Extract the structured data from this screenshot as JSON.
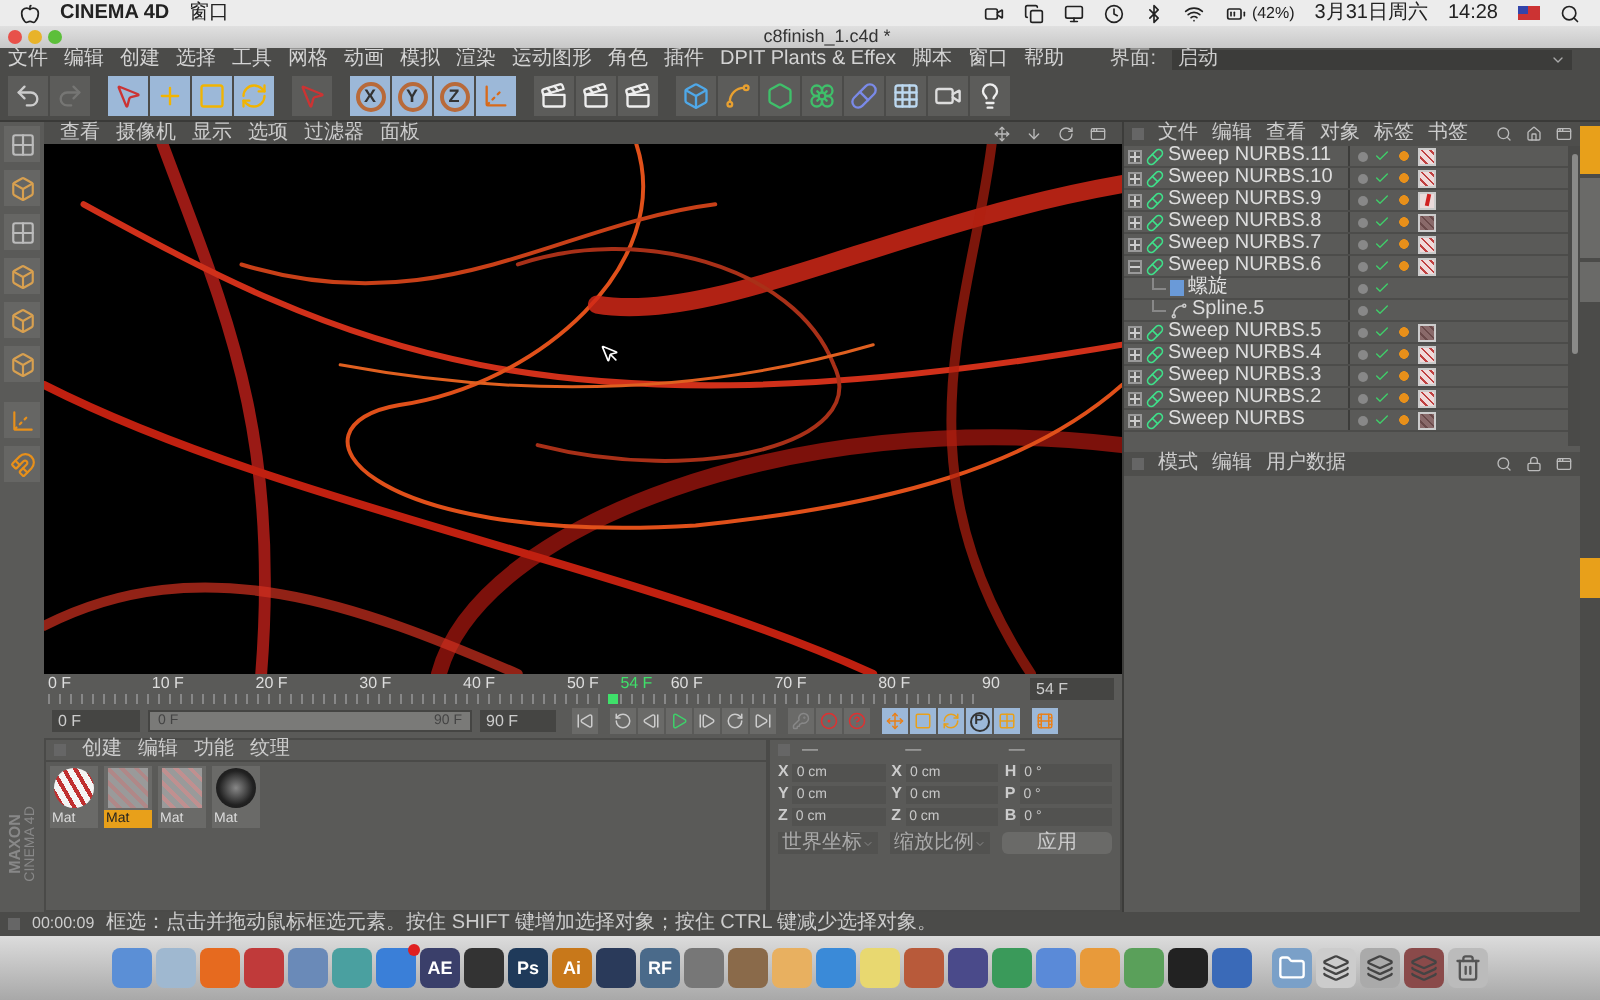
{
  "menubar": {
    "app": "CINEMA 4D",
    "menu": "窗口",
    "battery": "(42%)",
    "date": "3月31日周六",
    "time": "14:28"
  },
  "window": {
    "title": "c8finish_1.c4d *"
  },
  "menu": [
    "文件",
    "编辑",
    "创建",
    "选择",
    "工具",
    "网格",
    "动画",
    "模拟",
    "渲染",
    "运动图形",
    "角色",
    "插件",
    "DPIT Plants & Effex",
    "脚本",
    "窗口",
    "帮助"
  ],
  "layout": {
    "label": "界面:",
    "value": "启动"
  },
  "toolbar": [
    {
      "kind": "undo",
      "active": false
    },
    {
      "kind": "redo",
      "active": false,
      "disabled": true
    },
    {
      "kind": "select",
      "active": true
    },
    {
      "kind": "move",
      "active": true
    },
    {
      "kind": "scale",
      "active": true
    },
    {
      "kind": "rotate",
      "active": true
    },
    {
      "kind": "select",
      "active": false
    },
    {
      "kind": "axis",
      "label": "X",
      "active": true
    },
    {
      "kind": "axis",
      "label": "Y",
      "active": true
    },
    {
      "kind": "axis",
      "label": "Z",
      "active": true
    },
    {
      "kind": "coords",
      "active": true
    },
    {
      "kind": "render",
      "active": false
    },
    {
      "kind": "render",
      "active": false
    },
    {
      "kind": "render",
      "active": false
    },
    {
      "kind": "cube",
      "active": false
    },
    {
      "kind": "spline",
      "active": false
    },
    {
      "kind": "nurbs",
      "active": false
    },
    {
      "kind": "array",
      "active": false
    },
    {
      "kind": "deformer",
      "active": false
    },
    {
      "kind": "floor",
      "active": false
    },
    {
      "kind": "camera",
      "active": false
    },
    {
      "kind": "light",
      "active": false
    }
  ],
  "left_tools": [
    {
      "kind": "checker"
    },
    {
      "kind": "cube"
    },
    {
      "kind": "checker"
    },
    {
      "kind": "cube"
    },
    {
      "kind": "cube"
    },
    {
      "kind": "cube"
    },
    {
      "kind": "axis"
    },
    {
      "kind": "magnet"
    }
  ],
  "viewport": {
    "menu": [
      "查看",
      "摄像机",
      "显示",
      "选项",
      "过滤器",
      "面板"
    ]
  },
  "timeline": {
    "ticks": [
      "0 F",
      "10 F",
      "20 F",
      "30 F",
      "40 F",
      "50 F",
      "60 F",
      "70 F",
      "80 F",
      "90"
    ],
    "current": "54 F",
    "level": 0.6,
    "frame_field": "54 F"
  },
  "range": {
    "start": "0 F",
    "slider_start": "0 F",
    "slider_end": "90 F",
    "end": "90 F",
    "level": 1
  },
  "transport": [
    {
      "kind": "first"
    },
    {
      "kind": "loop-back"
    },
    {
      "kind": "prev"
    },
    {
      "kind": "play"
    },
    {
      "kind": "next"
    },
    {
      "kind": "loop"
    },
    {
      "kind": "last"
    },
    {
      "kind": "key"
    },
    {
      "kind": "record"
    },
    {
      "kind": "help"
    },
    {
      "kind": "move"
    },
    {
      "kind": "scale"
    },
    {
      "kind": "rotate"
    },
    {
      "kind": "param",
      "label": "P"
    },
    {
      "kind": "grid"
    },
    {
      "kind": "film"
    }
  ],
  "materials": {
    "menu": [
      "创建",
      "编辑",
      "功能",
      "纹理"
    ],
    "items": [
      {
        "label": "Mat",
        "kind": "striped-sphere",
        "selected": false
      },
      {
        "label": "Mat",
        "kind": "red",
        "selected": true
      },
      {
        "label": "Mat",
        "kind": "striped",
        "selected": false
      },
      {
        "label": "Mat",
        "kind": "dark-sphere",
        "selected": false
      }
    ]
  },
  "logo": {
    "brand": "MAXON",
    "product": "CINEMA 4D"
  },
  "coordinates": {
    "headers": [
      "—",
      "—",
      "—"
    ],
    "rows": [
      {
        "cells": [
          {
            "axis": "X",
            "value": "0 cm"
          },
          {
            "axis": "X",
            "value": "0 cm"
          },
          {
            "axis": "H",
            "value": "0 °"
          }
        ]
      },
      {
        "cells": [
          {
            "axis": "Y",
            "value": "0 cm"
          },
          {
            "axis": "Y",
            "value": "0 cm"
          },
          {
            "axis": "P",
            "value": "0 °"
          }
        ]
      },
      {
        "cells": [
          {
            "axis": "Z",
            "value": "0 cm"
          },
          {
            "axis": "Z",
            "value": "0 cm"
          },
          {
            "axis": "B",
            "value": "0 °"
          }
        ]
      }
    ],
    "mode": "世界坐标",
    "scale": "缩放比例",
    "apply": "应用"
  },
  "objects": {
    "menu": [
      "文件",
      "编辑",
      "查看",
      "对象",
      "标签",
      "书签"
    ],
    "items": [
      {
        "name": "Sweep NURBS.11",
        "kind": "sweep",
        "expanded": false,
        "material_tag": {
          "kind": "light"
        }
      },
      {
        "name": "Sweep NURBS.10",
        "kind": "sweep",
        "expanded": false,
        "material_tag": {
          "kind": "light"
        }
      },
      {
        "name": "Sweep NURBS.9",
        "kind": "sweep",
        "expanded": false,
        "material_tag": {
          "kind": "red"
        }
      },
      {
        "name": "Sweep NURBS.8",
        "kind": "sweep",
        "expanded": false,
        "material_tag": {
          "kind": "dark"
        }
      },
      {
        "name": "Sweep NURBS.7",
        "kind": "sweep",
        "expanded": false,
        "material_tag": {
          "kind": "light"
        }
      },
      {
        "name": "Sweep NURBS.6",
        "kind": "sweep",
        "expanded": true,
        "material_tag": {
          "kind": "light"
        },
        "children": [
          {
            "name": "螺旋",
            "kind": "helix"
          },
          {
            "name": "Spline.5",
            "kind": "spline"
          }
        ]
      },
      {
        "name": "Sweep NURBS.5",
        "kind": "sweep",
        "expanded": false,
        "material_tag": {
          "kind": "dark"
        }
      },
      {
        "name": "Sweep NURBS.4",
        "kind": "sweep",
        "expanded": false,
        "material_tag": {
          "kind": "light"
        }
      },
      {
        "name": "Sweep NURBS.3",
        "kind": "sweep",
        "expanded": false,
        "material_tag": {
          "kind": "light"
        }
      },
      {
        "name": "Sweep NURBS.2",
        "kind": "sweep",
        "expanded": false,
        "material_tag": {
          "kind": "light"
        }
      },
      {
        "name": "Sweep NURBS",
        "kind": "sweep",
        "expanded": false,
        "material_tag": {
          "kind": "dark"
        }
      }
    ]
  },
  "attributes": {
    "menu": [
      "模式",
      "编辑",
      "用户数据"
    ]
  },
  "status_bar": {
    "time": "00:00:09",
    "message": "框选：点击并拖动鼠标框选元素。按住 SHIFT 键增加选择对象；按住 CTRL 键减少选择对象。"
  },
  "dock": [
    {
      "kind": "app",
      "color": "#5b8fd6"
    },
    {
      "kind": "app",
      "color": "#9fb8d0"
    },
    {
      "kind": "app",
      "color": "#e66a1f"
    },
    {
      "kind": "app",
      "color": "#c03a3a"
    },
    {
      "kind": "app",
      "color": "#6a8ab8"
    },
    {
      "kind": "app",
      "color": "#4aa0a0"
    },
    {
      "kind": "app",
      "color": "#3a7fd8",
      "badge": true
    },
    {
      "kind": "app",
      "color": "#3a3f6a",
      "label": "AE"
    },
    {
      "kind": "app",
      "color": "#333333"
    },
    {
      "kind": "app",
      "color": "#1f3a5a",
      "label": "Ps"
    },
    {
      "kind": "app",
      "color": "#c8781a",
      "label": "Ai"
    },
    {
      "kind": "app",
      "color": "#2a3a5a"
    },
    {
      "kind": "app",
      "color": "#4a6a8a",
      "label": "RF"
    },
    {
      "kind": "app",
      "color": "#777777"
    },
    {
      "kind": "app",
      "color": "#8a6a4a"
    },
    {
      "kind": "app",
      "color": "#e8b060"
    },
    {
      "kind": "app",
      "color": "#3a8ad8"
    },
    {
      "kind": "app",
      "color": "#e8d870"
    },
    {
      "kind": "app",
      "color": "#b85a3a"
    },
    {
      "kind": "app",
      "color": "#4a4a8a"
    },
    {
      "kind": "app",
      "color": "#3a9a5a"
    },
    {
      "kind": "app",
      "color": "#5a8ad8"
    },
    {
      "kind": "app",
      "color": "#e89a3a"
    },
    {
      "kind": "app",
      "color": "#5aa05a"
    },
    {
      "kind": "app",
      "color": "#222222"
    },
    {
      "kind": "app",
      "color": "#3a6ab8"
    },
    {
      "kind": "folder",
      "color": "#7aa0c8"
    },
    {
      "kind": "stack",
      "color": "#cccccc"
    },
    {
      "kind": "stack",
      "color": "#aaaaaa"
    },
    {
      "kind": "stack",
      "color": "#8a4a4a"
    },
    {
      "kind": "trash",
      "color": "#bbbbbb"
    }
  ]
}
